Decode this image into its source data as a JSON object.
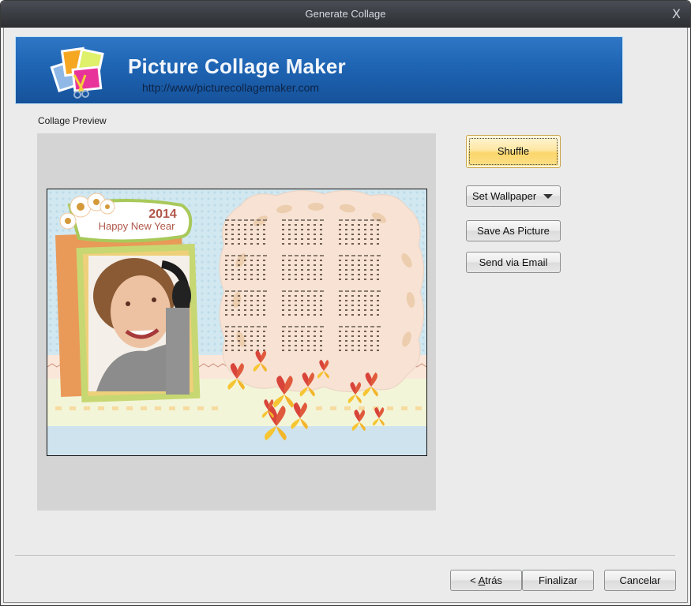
{
  "window": {
    "title": "Generate Collage",
    "close_label": "X"
  },
  "banner": {
    "app_name": "Picture Collage Maker",
    "url": "http://www/picturecollagemaker.com",
    "logo_icon": "photo-collage-scissors-logo"
  },
  "preview": {
    "label": "Collage Preview",
    "collage": {
      "year": "2014",
      "greeting": "Happy New Year",
      "calendar_months": 12,
      "theme_colors": {
        "background": "#cfe6f0",
        "calendar_card": "#f8e4d6",
        "frame_orange": "#e8954f",
        "frame_green": "#b7cf5c",
        "greeting_text": "#b0574a",
        "butterfly_red": "#d9443a",
        "butterfly_yellow": "#f6c531"
      }
    }
  },
  "actions": {
    "shuffle": "Shuffle",
    "set_wallpaper": "Set Wallpaper",
    "save_as_picture": "Save As Picture",
    "send_via_email": "Send via Email"
  },
  "footer": {
    "back_prefix": "< ",
    "back_accel": "A",
    "back_rest": "trás",
    "finish": "Finalizar",
    "cancel": "Cancelar"
  },
  "colors": {
    "titlebar": "#3a3d42",
    "banner_blue": "#1e64b3",
    "dialog_bg": "#ebebeb",
    "preview_bg": "#d4d4d4",
    "shuffle_highlight": "#fbd66b"
  }
}
